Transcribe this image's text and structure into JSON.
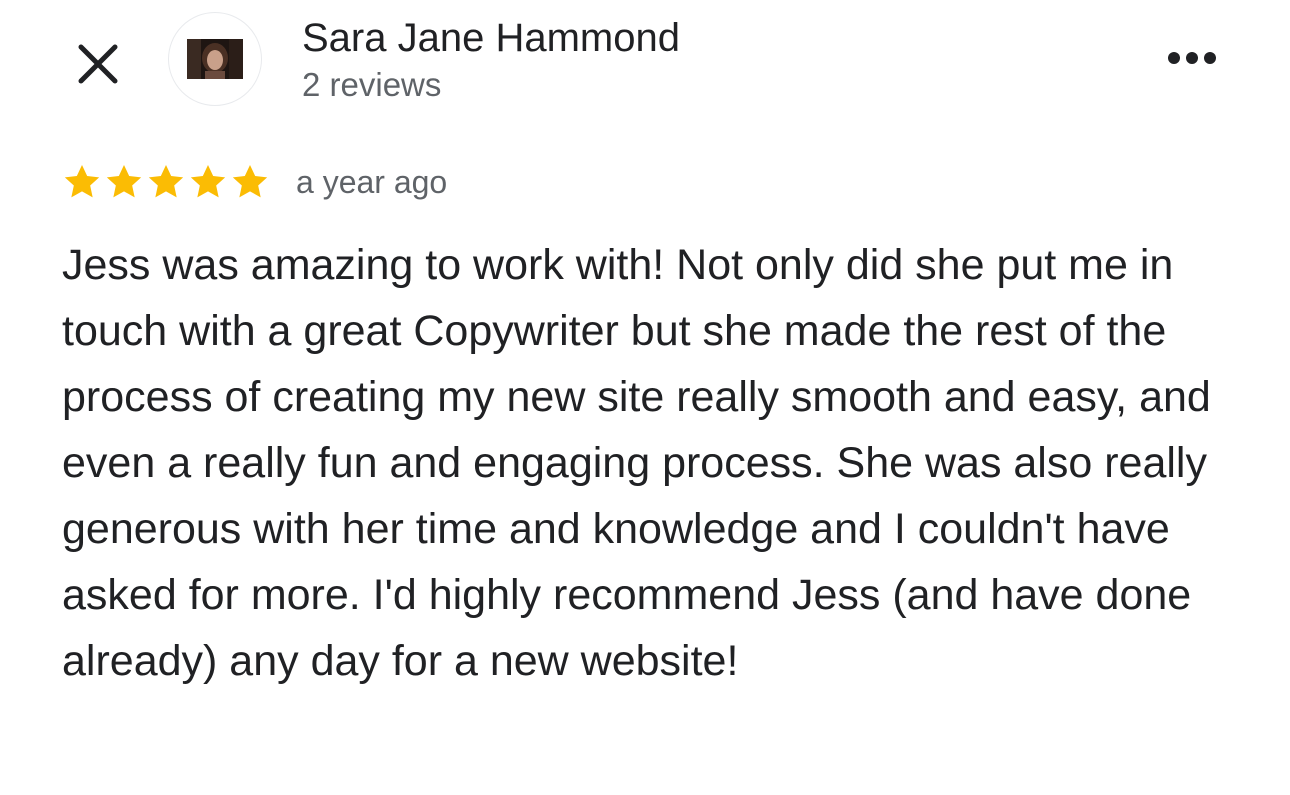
{
  "header": {
    "close_icon": "close-icon",
    "more_icon": "more-options-icon",
    "author": {
      "name": "Sara Jane Hammond",
      "review_count": "2 reviews"
    }
  },
  "review": {
    "rating": 5,
    "rating_max": 5,
    "star_color": "#fbbc04",
    "time": "a year ago",
    "text": "Jess was amazing to work with! Not only did she put me in touch with a great Copywriter but she made the rest of the process of creating my new site really smooth and easy, and even a really fun and engaging process. She was also really generous with her time and knowledge and I couldn't have asked for more. I'd highly recommend Jess (and have done already) any day for a new website!"
  }
}
